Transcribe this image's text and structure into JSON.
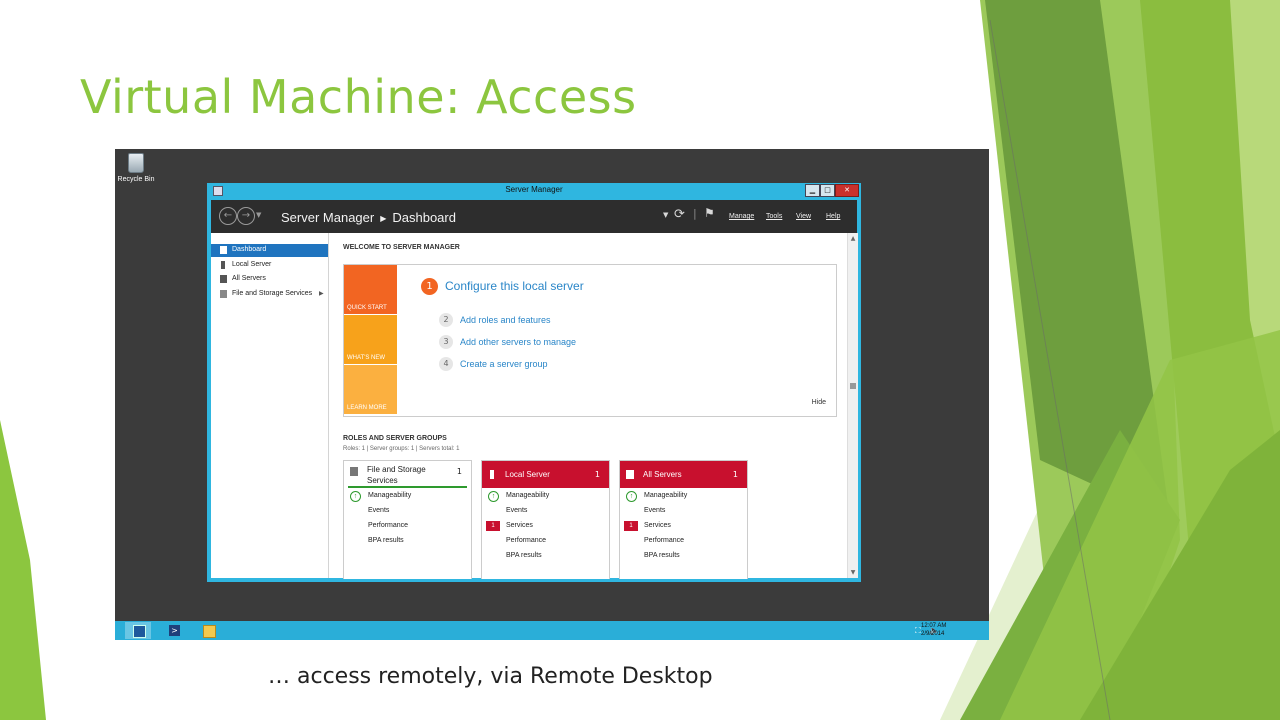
{
  "slide": {
    "title": "Virtual Machine: Access",
    "caption": "… access remotely, via Remote Desktop"
  },
  "desktop": {
    "recycle_bin_label": "Recycle Bin"
  },
  "window": {
    "title": "Server Manager",
    "breadcrumb_app": "Server Manager",
    "breadcrumb_page": "Dashboard",
    "menus": [
      "Manage",
      "Tools",
      "View",
      "Help"
    ]
  },
  "nav": {
    "items": [
      {
        "label": "Dashboard",
        "icon": "dashboard-icon",
        "active": true
      },
      {
        "label": "Local Server",
        "icon": "server-icon"
      },
      {
        "label": "All Servers",
        "icon": "servers-icon"
      },
      {
        "label": "File and Storage Services",
        "icon": "storage-icon"
      }
    ]
  },
  "welcome": {
    "heading": "WELCOME TO SERVER MANAGER",
    "tiles": [
      "QUICK START",
      "WHAT'S NEW",
      "LEARN MORE"
    ],
    "step1_number": "1",
    "step1_label": "Configure this local server",
    "steps": [
      {
        "number": "2",
        "label": "Add roles and features"
      },
      {
        "number": "3",
        "label": "Add other servers to manage"
      },
      {
        "number": "4",
        "label": "Create a server group"
      }
    ],
    "hide_label": "Hide"
  },
  "roles": {
    "heading": "ROLES AND SERVER GROUPS",
    "summary": "Roles: 1   |   Server groups: 1   |   Servers total: 1",
    "tiles": [
      {
        "name": "File and Storage Services",
        "count": "1",
        "rows": [
          {
            "label": "Manageability",
            "status": "ok"
          },
          {
            "label": "Events"
          },
          {
            "label": "Performance"
          },
          {
            "label": "BPA results"
          }
        ]
      },
      {
        "name": "Local Server",
        "count": "1",
        "rows": [
          {
            "label": "Manageability",
            "status": "ok"
          },
          {
            "label": "Events"
          },
          {
            "label": "Services",
            "badge": "1"
          },
          {
            "label": "Performance"
          },
          {
            "label": "BPA results"
          }
        ]
      },
      {
        "name": "All Servers",
        "count": "1",
        "rows": [
          {
            "label": "Manageability",
            "status": "ok"
          },
          {
            "label": "Events"
          },
          {
            "label": "Services",
            "badge": "1"
          },
          {
            "label": "Performance"
          },
          {
            "label": "BPA results"
          }
        ]
      }
    ]
  },
  "taskbar": {
    "time": "12:07 AM",
    "date": "2/9/2014"
  },
  "colors": {
    "accent_green": "#8cc63f",
    "window_border": "#2fb6e0",
    "quick_start": "#f26522",
    "alert_red": "#c8102e",
    "link_blue": "#2a86c8"
  }
}
